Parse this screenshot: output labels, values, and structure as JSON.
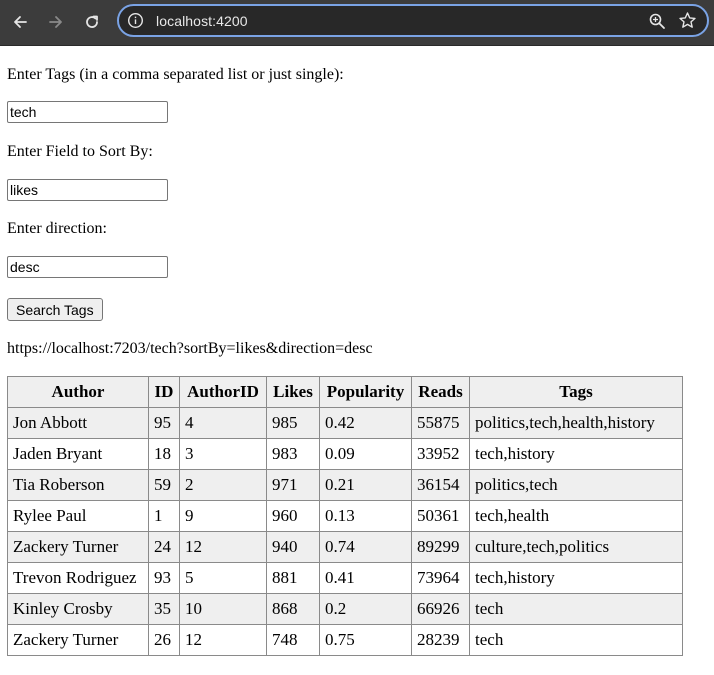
{
  "browser": {
    "url": "localhost:4200"
  },
  "form": {
    "tags_label": "Enter Tags (in a comma separated list or just single):",
    "tags_value": "tech",
    "sort_label": "Enter Field to Sort By:",
    "sort_value": "likes",
    "direction_label": "Enter direction:",
    "direction_value": "desc",
    "search_button": "Search Tags"
  },
  "request_url": "https://localhost:7203/tech?sortBy=likes&direction=desc",
  "table": {
    "headers": [
      "Author",
      "ID",
      "AuthorID",
      "Likes",
      "Popularity",
      "Reads",
      "Tags"
    ],
    "rows": [
      [
        "Jon Abbott",
        "95",
        "4",
        "985",
        "0.42",
        "55875",
        "politics,tech,health,history"
      ],
      [
        "Jaden Bryant",
        "18",
        "3",
        "983",
        "0.09",
        "33952",
        "tech,history"
      ],
      [
        "Tia Roberson",
        "59",
        "2",
        "971",
        "0.21",
        "36154",
        "politics,tech"
      ],
      [
        "Rylee Paul",
        "1",
        "9",
        "960",
        "0.13",
        "50361",
        "tech,health"
      ],
      [
        "Zackery Turner",
        "24",
        "12",
        "940",
        "0.74",
        "89299",
        "culture,tech,politics"
      ],
      [
        "Trevon Rodriguez",
        "93",
        "5",
        "881",
        "0.41",
        "73964",
        "tech,history"
      ],
      [
        "Kinley Crosby",
        "35",
        "10",
        "868",
        "0.2",
        "66926",
        "tech"
      ],
      [
        "Zackery Turner",
        "26",
        "12",
        "748",
        "0.75",
        "28239",
        "tech"
      ]
    ]
  }
}
